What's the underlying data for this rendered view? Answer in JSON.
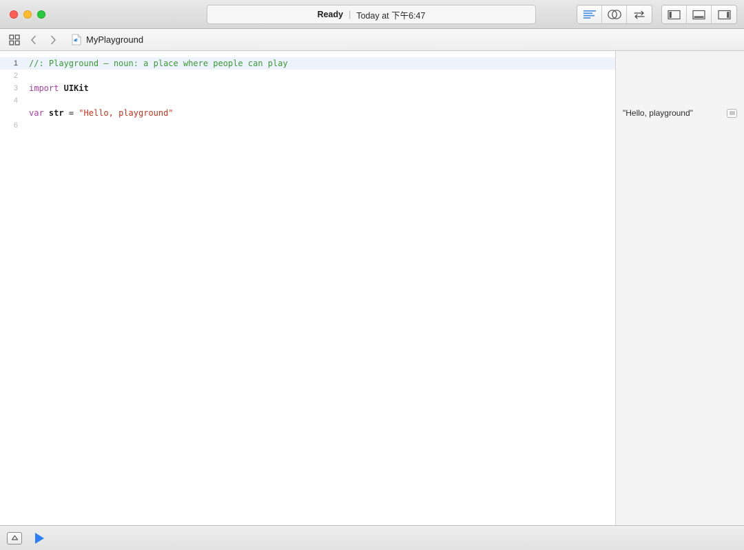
{
  "window": {
    "status": {
      "state": "Ready",
      "separator": "|",
      "time": "Today at 下午6:47"
    },
    "traffic_lights": [
      {
        "name": "close",
        "color": "#ff5f57"
      },
      {
        "name": "minimize",
        "color": "#ffbd2e"
      },
      {
        "name": "zoom",
        "color": "#28c940"
      }
    ]
  },
  "toolbar": {
    "editor_modes": [
      {
        "name": "standard-editor",
        "icon": "lines-icon",
        "active": true
      },
      {
        "name": "assistant-editor",
        "icon": "venn-circles-icon",
        "active": false
      },
      {
        "name": "version-editor",
        "icon": "arrows-swap-icon",
        "active": false
      }
    ],
    "view_toggles": [
      {
        "name": "navigator-panel",
        "icon": "panel-left-icon"
      },
      {
        "name": "debug-panel",
        "icon": "panel-bottom-icon"
      },
      {
        "name": "utilities-panel",
        "icon": "panel-right-icon"
      }
    ]
  },
  "jumpbar": {
    "grid_icon": "grid-squares-icon",
    "back_icon": "chevron-left-icon",
    "forward_icon": "chevron-right-icon",
    "file_icon": "playground-file-icon",
    "file_name": "MyPlayground"
  },
  "editor": {
    "lines": [
      {
        "number": "1",
        "highlighted": true,
        "tokens": [
          {
            "type": "comment",
            "text": "//: Playground — noun: a place where people can play"
          }
        ]
      },
      {
        "number": "2",
        "highlighted": false,
        "tokens": []
      },
      {
        "number": "3",
        "highlighted": false,
        "tokens": [
          {
            "type": "keyword",
            "text": "import"
          },
          {
            "type": "plain",
            "text": " "
          },
          {
            "type": "bold",
            "text": "UIKit"
          }
        ]
      },
      {
        "number": "4",
        "highlighted": false,
        "tokens": []
      },
      {
        "number": "",
        "highlighted": false,
        "tokens": [
          {
            "type": "keyword",
            "text": "var"
          },
          {
            "type": "plain",
            "text": " "
          },
          {
            "type": "bold",
            "text": "str"
          },
          {
            "type": "plain",
            "text": " = "
          },
          {
            "type": "string",
            "text": "\"Hello, playground\""
          }
        ]
      },
      {
        "number": "6",
        "highlighted": false,
        "tokens": []
      }
    ],
    "colors": {
      "comment": "#3a9a35",
      "keyword": "#ad3da4",
      "string": "#d12f1b",
      "plain": "#1f1f1f",
      "highlight_background": "#eef3fb"
    }
  },
  "results_sidebar": {
    "rows": [
      {
        "line_index": 4,
        "value": "\"Hello, playground\"",
        "button_icon": "value-history-icon"
      }
    ]
  },
  "bottombar": {
    "debug_toggle_icon": "debug-area-toggle-icon",
    "run_button_icon": "play-triangle-icon",
    "run_button_color": "#2d7ff9"
  }
}
